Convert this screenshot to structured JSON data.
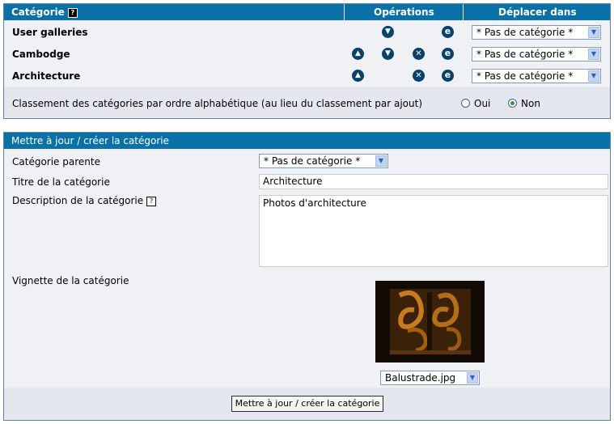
{
  "categories_table": {
    "headers": {
      "category": "Catégorie",
      "operations": "Opérations",
      "move_to": "Déplacer dans"
    },
    "help_glyph": "?",
    "rows": [
      {
        "name": "User galleries",
        "ops": [
          "down",
          "edit"
        ],
        "move_select": "* Pas de catégorie *"
      },
      {
        "name": "Cambodge",
        "ops": [
          "up",
          "down",
          "delete",
          "edit"
        ],
        "move_select": "* Pas de catégorie *"
      },
      {
        "name": "Architecture",
        "ops": [
          "up",
          "delete",
          "edit"
        ],
        "move_select": "* Pas de catégorie *"
      }
    ],
    "icons": {
      "up": "arrow-up-icon",
      "down": "arrow-down-icon",
      "delete": "x-delete-icon",
      "edit": "e-edit-icon"
    },
    "sort_label": "Classement des catégories par ordre alphabétique (au lieu du classement par ajout)",
    "sort_options": {
      "yes": "Oui",
      "no": "Non"
    },
    "sort_selected": "Non"
  },
  "edit_form": {
    "title": "Mettre à jour / créer la catégorie",
    "parent_label": "Catégorie parente",
    "parent_value": "* Pas de catégorie *",
    "title_label": "Titre de la catégorie",
    "title_value": "Architecture",
    "description_label": "Description de la catégorie",
    "description_value": "Photos d'architecture",
    "thumbnail_label": "Vignette de la catégorie",
    "thumbnail_file": "Balustrade.jpg",
    "submit_label": "Mettre à jour / créer la catégorie"
  },
  "colors": {
    "header_blue": "#0a71a8",
    "panel_bg": "#e4e7ee",
    "icon_navy": "#08426b",
    "radio_green": "#2ea01c"
  }
}
